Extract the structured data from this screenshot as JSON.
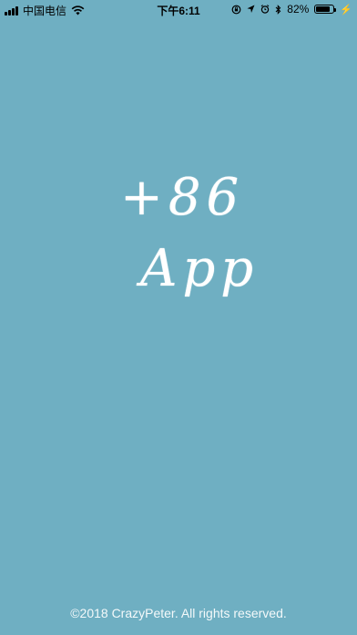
{
  "status_bar": {
    "carrier": "中国电信",
    "time": "下午6:11",
    "battery_percent_text": "82%",
    "battery_level": 0.82,
    "signal_bars": 4,
    "icons": [
      "signal-icon",
      "wifi-icon",
      "rotation-lock-icon",
      "location-icon",
      "alarm-icon",
      "bluetooth-icon",
      "battery-icon",
      "charging-icon"
    ]
  },
  "logo": {
    "line1": "+86",
    "line2": "App"
  },
  "footer": {
    "copyright": "©2018 CrazyPeter. All rights reserved."
  },
  "colors": {
    "background": "#6FAFC2",
    "text": "#FFFFFF"
  }
}
